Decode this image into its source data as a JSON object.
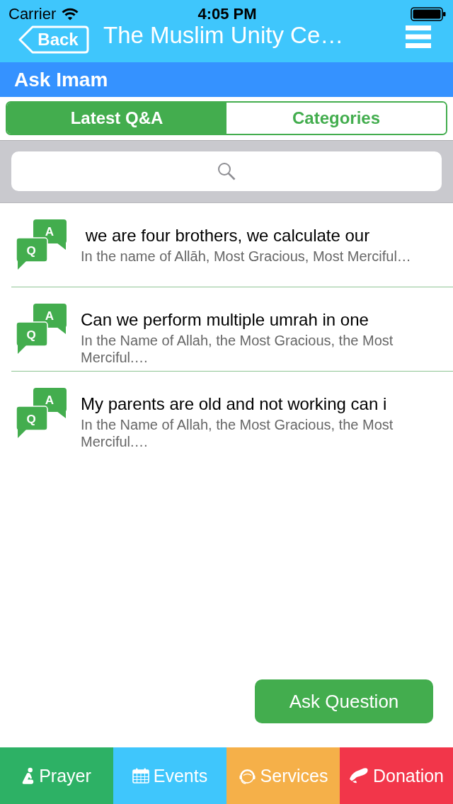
{
  "status_bar": {
    "carrier": "Carrier",
    "time": "4:05 PM"
  },
  "nav_bar": {
    "back": "Back",
    "title": "The Muslim Unity Ce…"
  },
  "section": {
    "title": "Ask Imam"
  },
  "segments": [
    {
      "label": "Latest Q&A",
      "selected": true
    },
    {
      "label": "Categories",
      "selected": false
    }
  ],
  "questions": [
    {
      "q_letter": "Q",
      "a_letter": "A",
      "title": " we are four brothers, we calculate our",
      "excerpt": "In the name of Allāh, Most Gracious, Most Merciful…"
    },
    {
      "q_letter": "Q",
      "a_letter": "A",
      "title": "Can we perform multiple umrah in one",
      "excerpt": "In the Name of Allah, the Most Gracious, the Most Merciful.…"
    },
    {
      "q_letter": "Q",
      "a_letter": "A",
      "title": "My parents are old and not working can i",
      "excerpt": "In the Name of Allah, the Most Gracious, the Most Merciful.…"
    }
  ],
  "ask_button": "Ask Question",
  "tabs": [
    {
      "kind": "prayer",
      "label": "Prayer",
      "color": "#2db165"
    },
    {
      "kind": "events",
      "label": "Events",
      "color": "#3fc6fc"
    },
    {
      "kind": "services",
      "label": "Services",
      "color": "#f5b049"
    },
    {
      "kind": "donation",
      "label": "Donation",
      "color": "#f2364a"
    }
  ]
}
